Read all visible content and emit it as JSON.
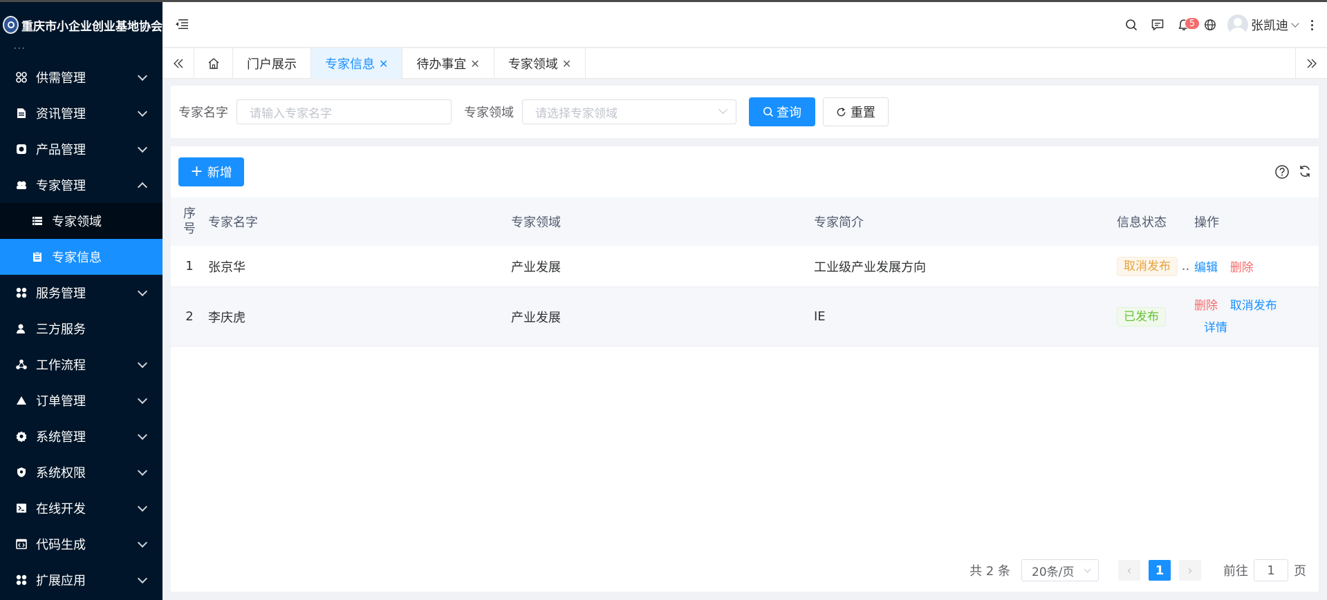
{
  "brand": {
    "name": "重庆市小企业创业基地协会"
  },
  "sidebar": {
    "items": [
      {
        "label": "供需管理",
        "icon": "grid-icon"
      },
      {
        "label": "资讯管理",
        "icon": "document-icon"
      },
      {
        "label": "产品管理",
        "icon": "product-icon"
      },
      {
        "label": "专家管理",
        "icon": "users-icon",
        "expanded": true
      },
      {
        "label": "专家领域",
        "icon": "list-icon",
        "sub": true
      },
      {
        "label": "专家信息",
        "icon": "clipboard-icon",
        "sub": true,
        "active": true
      },
      {
        "label": "服务管理",
        "icon": "apps-icon"
      },
      {
        "label": "三方服务",
        "icon": "user-icon"
      },
      {
        "label": "工作流程",
        "icon": "flow-icon"
      },
      {
        "label": "订单管理",
        "icon": "triangle-icon"
      },
      {
        "label": "系统管理",
        "icon": "gear-icon"
      },
      {
        "label": "系统权限",
        "icon": "shield-icon"
      },
      {
        "label": "在线开发",
        "icon": "terminal-icon"
      },
      {
        "label": "代码生成",
        "icon": "code-icon"
      },
      {
        "label": "扩展应用",
        "icon": "apps-icon"
      }
    ]
  },
  "header": {
    "notification_count": "5",
    "user_name": "张凯迪"
  },
  "tabs": [
    {
      "label": "门户展示",
      "closable": false
    },
    {
      "label": "专家信息",
      "closable": true,
      "active": true
    },
    {
      "label": "待办事宜",
      "closable": true
    },
    {
      "label": "专家领域",
      "closable": true
    }
  ],
  "search": {
    "name_label": "专家名字",
    "name_placeholder": "请输入专家名字",
    "field_label": "专家领域",
    "field_placeholder": "请选择专家领域",
    "query_label": "查询",
    "reset_label": "重置"
  },
  "toolbar": {
    "add_label": "新增"
  },
  "table": {
    "columns": [
      "序号",
      "专家名字",
      "专家领域",
      "专家简介",
      "信息状态",
      "操作"
    ],
    "rows": [
      {
        "idx": "1",
        "name": "张京华",
        "field": "产业发展",
        "intro": "工业级产业发展方向",
        "status": "取消发布",
        "ops": [
          "编辑",
          "删除"
        ]
      },
      {
        "idx": "2",
        "name": "李庆虎",
        "field": "产业发展",
        "intro": "IE",
        "status": "已发布",
        "ops": [
          "删除",
          "取消发布",
          "详情"
        ]
      }
    ]
  },
  "pagination": {
    "total": "共 2 条",
    "page_size": "20条/页",
    "current_page": "1",
    "goto_prefix": "前往",
    "goto_value": "1",
    "goto_suffix": "页"
  },
  "colors": {
    "primary": "#1890ff",
    "sidebar": "#001529",
    "danger": "#f56c6c",
    "warning": "#e6a23c",
    "success": "#67c23a"
  }
}
